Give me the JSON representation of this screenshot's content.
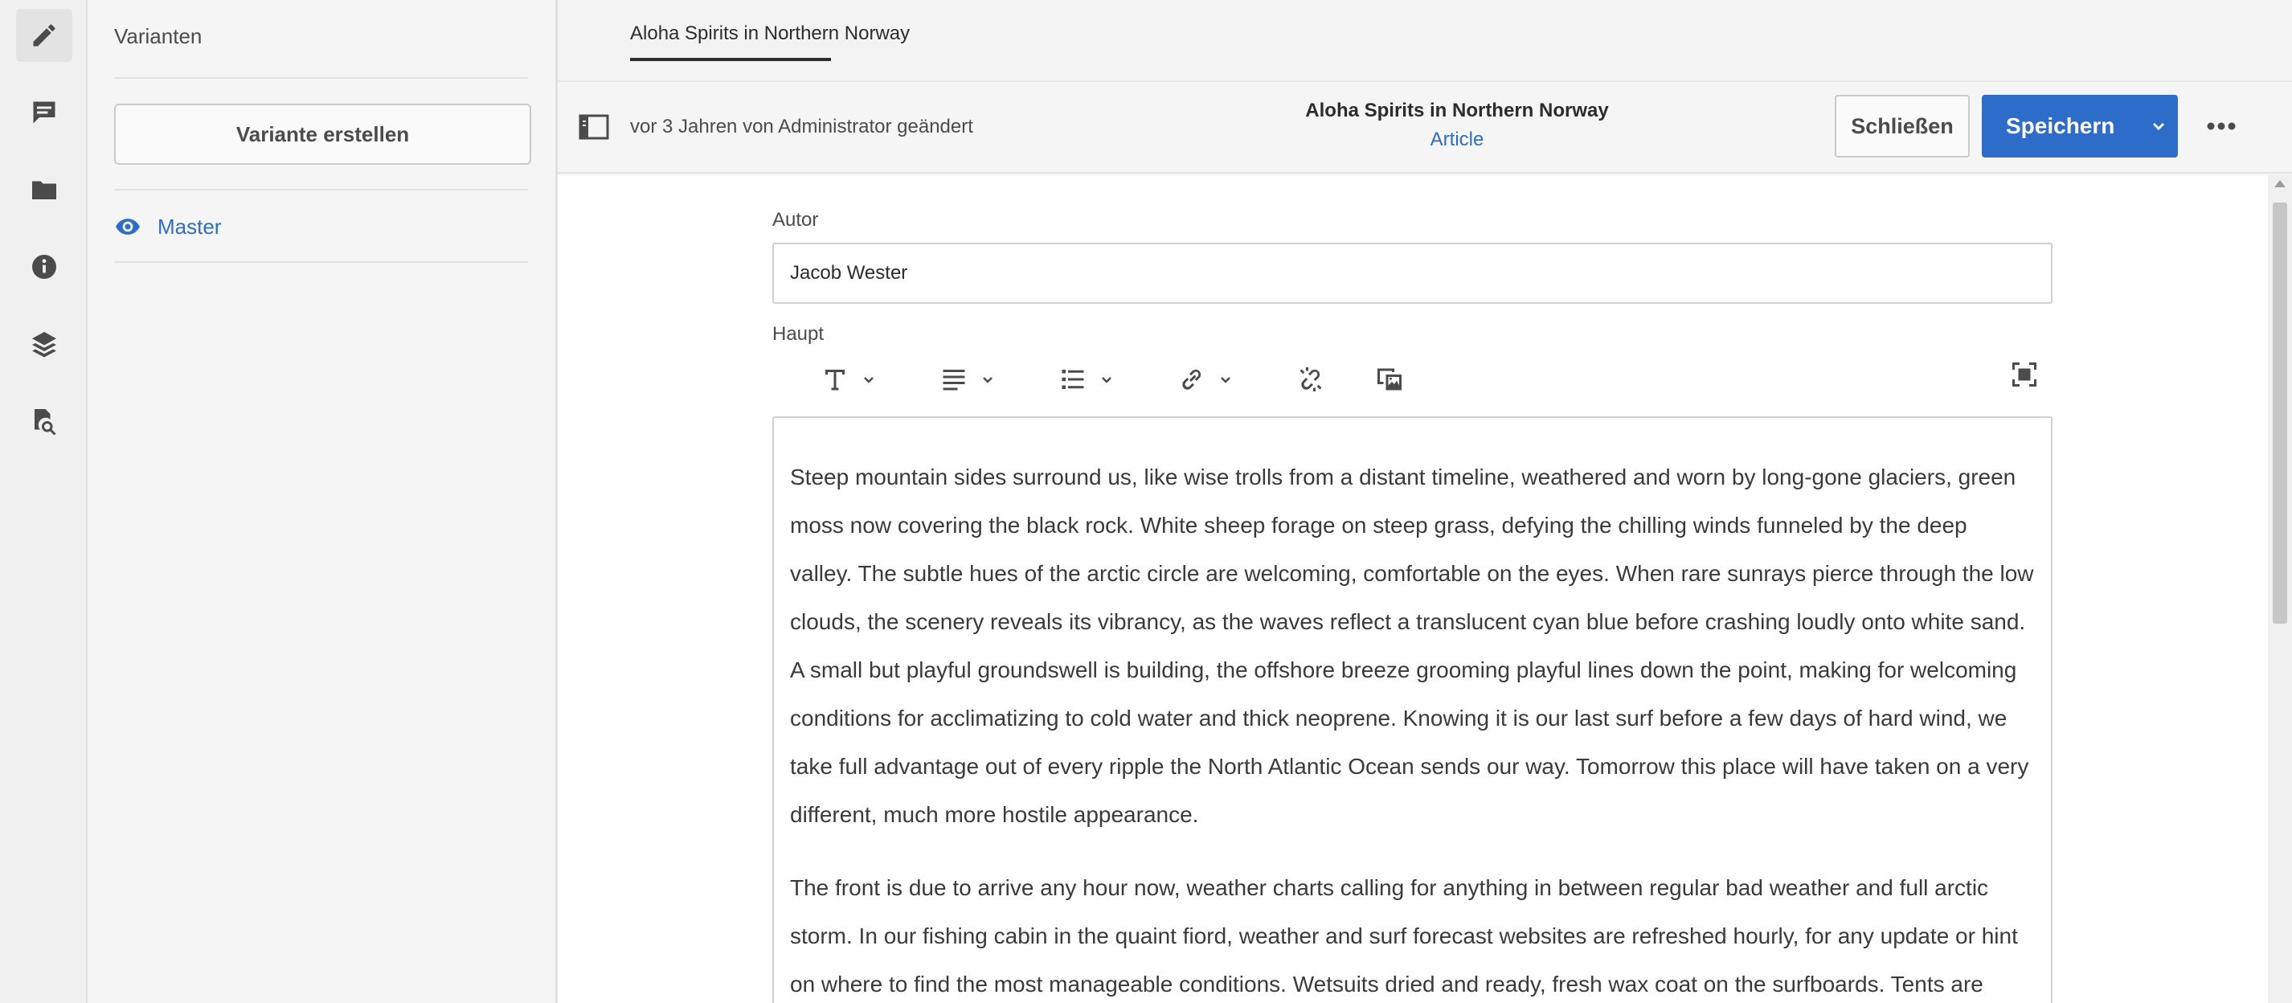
{
  "rail": {
    "items": [
      {
        "name": "edit",
        "icon": "pencil-icon",
        "active": true
      },
      {
        "name": "annotations",
        "icon": "comment-icon",
        "active": false
      },
      {
        "name": "assets",
        "icon": "folder-icon",
        "active": false
      },
      {
        "name": "metadata",
        "icon": "info-icon",
        "active": false
      },
      {
        "name": "structure",
        "icon": "layers-icon",
        "active": false
      },
      {
        "name": "references",
        "icon": "file-search-icon",
        "active": false
      }
    ]
  },
  "variants_panel": {
    "title": "Varianten",
    "create_button": "Variante erstellen",
    "items": [
      {
        "label": "Master",
        "icon": "eye-icon"
      }
    ]
  },
  "tabs": [
    {
      "label": "Aloha Spirits in Northern Norway",
      "active": true
    }
  ],
  "header": {
    "modified_text": "vor 3 Jahren von Administrator geändert",
    "title": "Aloha Spirits in Northern Norway",
    "model": "Article",
    "close_label": "Schließen",
    "save_label": "Speichern"
  },
  "form": {
    "author_label": "Autor",
    "author_value": "Jacob Wester",
    "main_label": "Haupt",
    "paragraphs": [
      "Steep mountain sides surround us, like wise trolls from a distant timeline, weathered and worn by long-gone glaciers, green moss now covering the black rock. White sheep forage on steep grass, defying the chilling winds funneled by the deep valley. The subtle hues of the arctic circle are welcoming, comfortable on the eyes. When rare sunrays pierce through the low clouds, the scenery reveals its vibrancy, as the waves reflect a translucent cyan blue before crashing loudly onto white sand. A small but playful groundswell is building, the offshore breeze grooming playful lines down the point, making for welcoming conditions for acclimatizing to cold water and thick neoprene. Knowing it is our last surf before a few days of hard wind, we take full advantage out of every ripple the North Atlantic Ocean sends our way. Tomorrow this place will have taken on a very different, much more hostile appearance.",
      "The front is due to arrive any hour now, weather charts calling for anything in between regular bad weather and full arctic storm. In our fishing cabin in the quaint fiord, weather and surf forecast websites are refreshed hourly, for any update or hint on where to find the most manageable conditions. Wetsuits dried and ready, fresh wax coat on the surfboards. Tents are"
    ]
  },
  "colors": {
    "accent": "#2d6cc8",
    "rail_bg": "#f0f0f0",
    "panel_bg": "#f5f5f5",
    "editor_bg": "#ffffff"
  }
}
